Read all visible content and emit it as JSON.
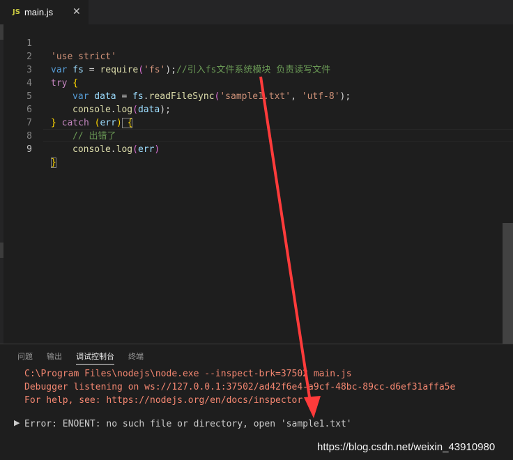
{
  "tab": {
    "icon_text": "JS",
    "file_name": "main.js",
    "close_glyph": "✕"
  },
  "editor": {
    "line_numbers": [
      "1",
      "2",
      "3",
      "4",
      "5",
      "6",
      "7",
      "8",
      "9"
    ],
    "tokens": {
      "l1_str": "'use strict'",
      "l2_var": "var",
      "l2_name": " fs",
      "l2_eq": " = ",
      "l2_require": "require",
      "l2_open": "(",
      "l2_arg": "'fs'",
      "l2_close": ");",
      "l2_comment": "//引入fs文件系统模块 负责读写文件",
      "l3_try": "try",
      "l3_brace": " {",
      "l4_var": "var",
      "l4_data": " data",
      "l4_eq": " = ",
      "l4_fs": "fs",
      "l4_dot": ".",
      "l4_fn": "readFileSync",
      "l4_open": "(",
      "l4_arg1": "'sample1.txt'",
      "l4_comma": ", ",
      "l4_arg2": "'utf-8'",
      "l4_close": ");",
      "l5_console": "console",
      "l5_dot": ".",
      "l5_log": "log",
      "l5_open": "(",
      "l5_arg": "data",
      "l5_close": ");",
      "l6_close_brace": "}",
      "l6_catch": " catch",
      "l6_paren_open": " (",
      "l6_err": "err",
      "l6_paren_close": ")",
      "l6_brace": " {",
      "l7_comment": "// 出错了",
      "l8_console": "console",
      "l8_dot": ".",
      "l8_log": "log",
      "l8_open": "(",
      "l8_arg": "err",
      "l8_close": ")",
      "l9_brace": "}"
    }
  },
  "panel": {
    "tabs": [
      "问题",
      "输出",
      "调试控制台",
      "终端"
    ],
    "active_tab": "调试控制台",
    "output_lines": [
      "C:\\Program Files\\nodejs\\node.exe --inspect-brk=37502 main.js",
      "Debugger listening on ws://127.0.0.1:37502/ad42f6e4-a9cf-48bc-89cc-d6ef31affa5e",
      "For help, see: https://nodejs.org/en/docs/inspector"
    ],
    "error_line": "Error: ENOENT: no such file or directory, open 'sample1.txt'",
    "expand_glyph": "▶"
  },
  "watermark": "https://blog.csdn.net/weixin_43910980",
  "colors": {
    "editor_bg": "#1e1e1e",
    "tabbar_bg": "#252526",
    "annotation_arrow": "#ff3b3b"
  },
  "icons": {
    "file_icon": "js-icon",
    "close": "close-icon",
    "expand": "chevron-right-icon"
  }
}
